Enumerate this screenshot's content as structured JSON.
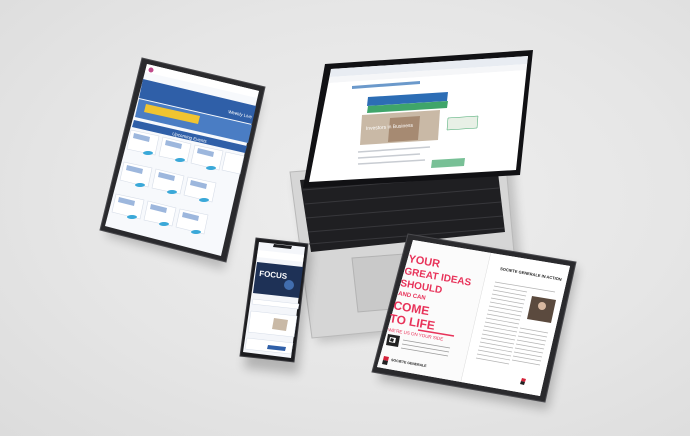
{
  "scene": {
    "background_color": "#e6e6e6",
    "devices": [
      "tablet-left",
      "laptop",
      "phone",
      "tablet-right"
    ]
  },
  "tablet_left": {
    "header_badge": "Weekly Live",
    "section_title": "Upcoming Events",
    "accent": "#2f5fa8"
  },
  "laptop": {
    "banner_text": "Investors in Business",
    "accent": "#2c6db5"
  },
  "phone": {
    "hero_title": "FOCUS",
    "accent": "#2f5fa8"
  },
  "tablet_right": {
    "headline_lines": [
      "YOUR",
      "GREAT IDEAS",
      "SHOULD",
      "AND CAN",
      "COME",
      "TO LIFE"
    ],
    "subline": "WE'RE US ON YOUR SIDE",
    "bank_name": "SOCIETE GENERALE",
    "article_title": "SOCIETE GENERALE IN ACTION",
    "headline_color": "#e8335a",
    "bank_color": "#d4233a"
  }
}
